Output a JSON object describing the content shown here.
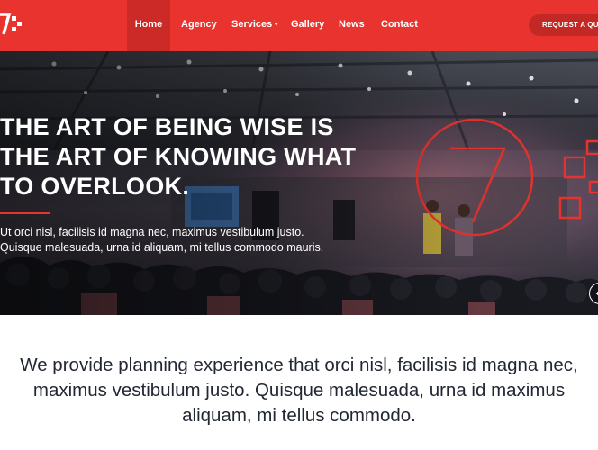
{
  "nav": {
    "items": [
      {
        "label": "Home",
        "active": true
      },
      {
        "label": "Agency"
      },
      {
        "label": "Services",
        "has_dropdown": true
      },
      {
        "label": "Gallery"
      },
      {
        "label": "News"
      },
      {
        "label": "Contact"
      }
    ],
    "cta_label": "REQUEST A QUOTE",
    "logo_icon": "seven-logo-icon"
  },
  "hero": {
    "title_lines": [
      "THE ART OF BEING WISE IS",
      "THE ART OF KNOWING WHAT",
      "TO OVERLOOK."
    ],
    "text_lines": [
      "Ut orci nisl, facilisis id magna nec, maximus vestibulum justo.",
      "Quisque malesuada, urna id aliquam, mi tellus commodo mauris."
    ],
    "next_icon": "chevron-left-icon"
  },
  "intro": {
    "lines": [
      "We provide planning experience that orci nisl, facilisis id magna nec,",
      "maximus vestibulum justo. Quisque malesuada, urna id maximus",
      "aliquam, mi tellus commodo."
    ]
  },
  "colors": {
    "brand_red": "#e8332e",
    "nav_active": "#cc2a26",
    "cta_bg": "#c22824",
    "intro_text": "#222833"
  }
}
